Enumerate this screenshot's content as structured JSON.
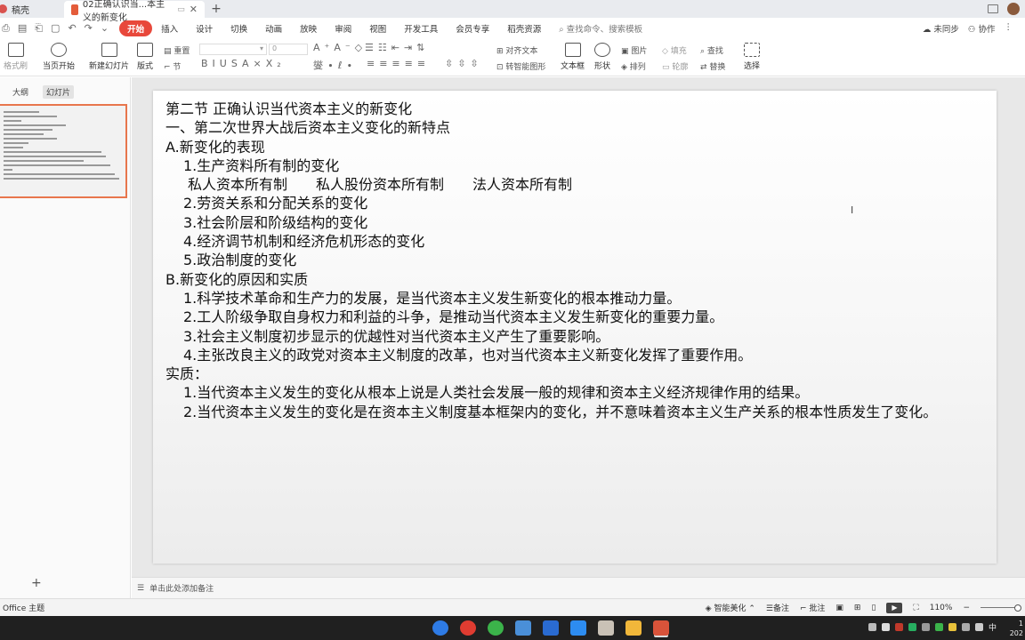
{
  "tabs": {
    "home_label": "稿壳",
    "doc_label": "02正确认识当...本主义的新变化",
    "new_tab": "+"
  },
  "menu": {
    "items": [
      "开始",
      "插入",
      "设计",
      "切换",
      "动画",
      "放映",
      "审阅",
      "视图",
      "开发工具",
      "会员专享",
      "稻壳资源"
    ],
    "search_placeholder": "查找命令、搜索模板",
    "unsynced": "未同步",
    "collab": "协作"
  },
  "ribbon": {
    "format_brush": "格式刷",
    "from_start": "当页开始",
    "new_slide": "新建幻灯片",
    "layout": "版式",
    "section": "节",
    "reset": "重置",
    "font_size": "0",
    "align_text": "对齐文本",
    "to_smartart": "转智能图形",
    "textbox": "文本框",
    "shape": "形状",
    "picture": "图片",
    "arrange": "排列",
    "fill": "填充",
    "outline": "轮廓",
    "find": "查找",
    "replace": "替换",
    "select": "选择"
  },
  "leftpanel": {
    "tab_outline": "大纲",
    "tab_slides": "幻灯片",
    "add": "+"
  },
  "slide": {
    "lines": [
      "第二节 正确认识当代资本主义的新变化",
      "一、第二次世界大战后资本主义变化的新特点",
      "A.新变化的表现",
      "1.生产资料所有制的变化",
      "私人资本所有制　　私人股份资本所有制　　法人资本所有制",
      "2.劳资关系和分配关系的变化",
      "3.社会阶层和阶级结构的变化",
      "4.经济调节机制和经济危机形态的变化",
      "5.政治制度的变化",
      "B.新变化的原因和实质",
      "1.科学技术革命和生产力的发展，是当代资本主义发生新变化的根本推动力量。",
      "2.工人阶级争取自身权力和利益的斗争，是推动当代资本主义发生新变化的重要力量。",
      "3.社会主义制度初步显示的优越性对当代资本主义产生了重要影响。",
      "4.主张改良主义的政党对资本主义制度的改革，也对当代资本主义新变化发挥了重要作用。",
      "实质：",
      "1.当代资本主义发生的变化从根本上说是人类社会发展一般的规律和资本主义经济规律作用的结果。",
      "2.当代资本主义发生的变化是在资本主义制度基本框架内的变化，并不意味着资本主义生产关系的根本性质发生了变化。"
    ]
  },
  "notes": {
    "placeholder": "单击此处添加备注"
  },
  "status": {
    "theme": "Office 主题",
    "smart_beautify": "智能美化",
    "notes": "备注",
    "comment": "批注",
    "zoom": "110%"
  },
  "taskbar": {
    "ime": "中",
    "clock_line1": "1",
    "clock_line2": "202"
  },
  "colors": {
    "accent": "#e8483b",
    "thumb_border": "#e8764d",
    "taskbar": "#202020"
  }
}
